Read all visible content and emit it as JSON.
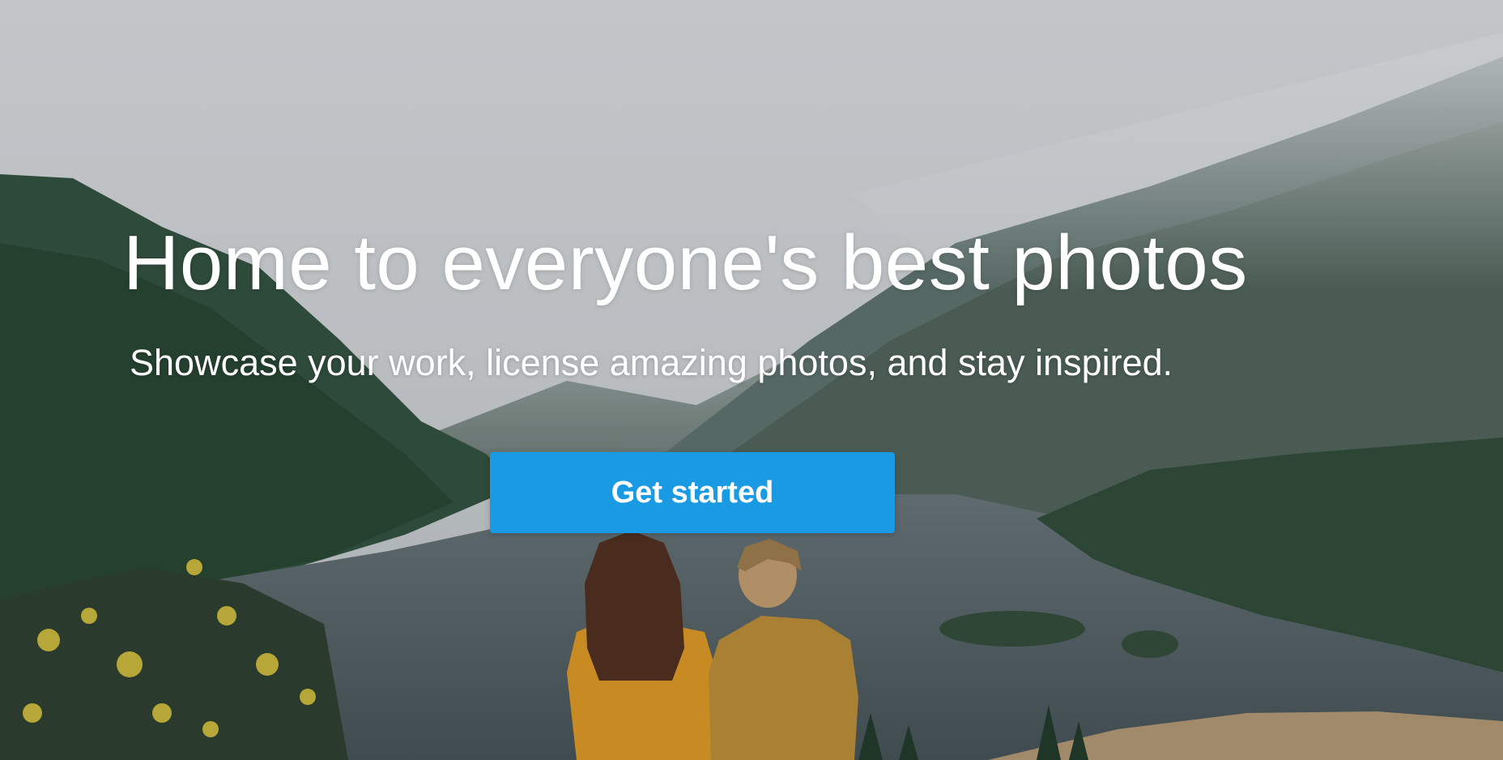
{
  "hero": {
    "headline": "Home to everyone's best photos",
    "subheadline": "Showcase your work, license amazing photos, and stay inspired.",
    "cta_label": "Get started",
    "background_image": "mountain-lake-couple-photo"
  },
  "colors": {
    "cta_background": "#1a9ae3",
    "text": "#ffffff"
  }
}
